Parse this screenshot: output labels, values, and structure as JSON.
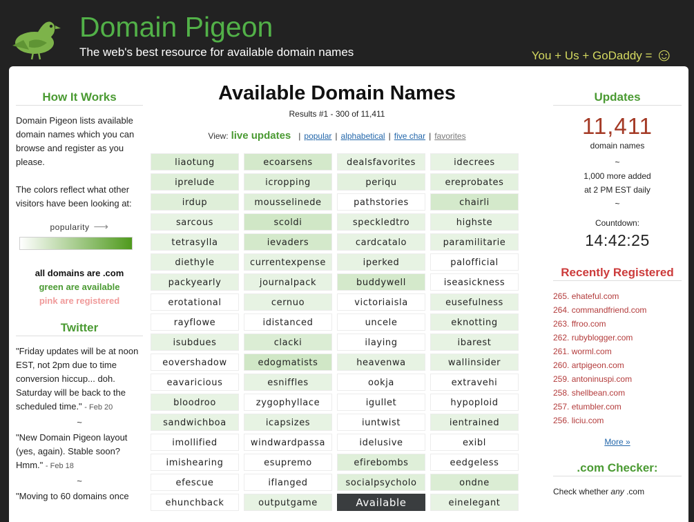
{
  "header": {
    "site_title": "Domain Pigeon",
    "tagline": "The web's best resource for available domain names",
    "partner_text": "You + Us + GoDaddy =",
    "partner_glyph": "☺",
    "logo_icon": "pigeon-icon"
  },
  "left": {
    "how_title": "How It Works",
    "how_text": "Domain Pigeon lists available domain names which you can browse and register as you please.",
    "colors_text": "The colors reflect what other visitors have been looking at:",
    "popularity_label": "popularity",
    "popularity_arrow": "⟶",
    "key_all": "all domains are .com",
    "key_green": "green are available",
    "key_pink": "pink are registered",
    "twitter_title": "Twitter",
    "tweets": [
      {
        "text": "\"Friday updates will be at noon EST, not 2pm due to time conversion hiccup... doh. Saturday will be back to the scheduled time.\"",
        "date": "- Feb 20"
      },
      {
        "text": "\"New Domain Pigeon layout (yes, again). Stable soon? Hmm.\"",
        "date": "- Feb 18"
      },
      {
        "text": "\"Moving to 60 domains once",
        "date": ""
      }
    ],
    "tilde": "~"
  },
  "center": {
    "title": "Available Domain Names",
    "results": "Results #1 - 300 of 11,411",
    "view_label": "View:",
    "views": {
      "live": "live updates",
      "popular": "popular",
      "alphabetical": "alphabetical",
      "five_char": "five char",
      "favorites": "favorites"
    },
    "domains": [
      [
        "liaotung",
        0.45
      ],
      [
        "ecoarsens",
        0.55
      ],
      [
        "dealsfavorites",
        0.3
      ],
      [
        "idecrees",
        0.3
      ],
      [
        "iprelude",
        0.4
      ],
      [
        "icropping",
        0.4
      ],
      [
        "periqu",
        0.35
      ],
      [
        "ereprobates",
        0.35
      ],
      [
        "irdup",
        0.4
      ],
      [
        "mousselinede",
        0.4
      ],
      [
        "pathstories",
        0.0
      ],
      [
        "chairli",
        0.55
      ],
      [
        "sarcous",
        0.3
      ],
      [
        "scoldi",
        0.6
      ],
      [
        "speckledtro",
        0.3
      ],
      [
        "highste",
        0.3
      ],
      [
        "tetrasylla",
        0.3
      ],
      [
        "ievaders",
        0.55
      ],
      [
        "cardcatalo",
        0.3
      ],
      [
        "paramilitarie",
        0.3
      ],
      [
        "diethyle",
        0.3
      ],
      [
        "currentexpense",
        0.3
      ],
      [
        "iperked",
        0.3
      ],
      [
        "palofficial",
        0.0
      ],
      [
        "packyearly",
        0.3
      ],
      [
        "journalpack",
        0.3
      ],
      [
        "buddywell",
        0.55
      ],
      [
        "iseasickness",
        0.0
      ],
      [
        "erotational",
        0.0
      ],
      [
        "cernuo",
        0.3
      ],
      [
        "victoriaisla",
        0.0
      ],
      [
        "eusefulness",
        0.3
      ],
      [
        "rayflowe",
        0.0
      ],
      [
        "idistanced",
        0.0
      ],
      [
        "uncele",
        0.0
      ],
      [
        "eknotting",
        0.3
      ],
      [
        "isubdues",
        0.3
      ],
      [
        "clacki",
        0.45
      ],
      [
        "ilaying",
        0.0
      ],
      [
        "ibarest",
        0.3
      ],
      [
        "eovershadow",
        0.0
      ],
      [
        "edogmatists",
        0.6
      ],
      [
        "heavenwa",
        0.3
      ],
      [
        "wallinsider",
        0.3
      ],
      [
        "eavaricious",
        0.0
      ],
      [
        "esniffles",
        0.3
      ],
      [
        "ookja",
        0.0
      ],
      [
        "extravehi",
        0.0
      ],
      [
        "bloodroo",
        0.3
      ],
      [
        "zygophyllace",
        0.0
      ],
      [
        "igullet",
        0.0
      ],
      [
        "hypoploid",
        0.0
      ],
      [
        "sandwichboa",
        0.3
      ],
      [
        "icapsizes",
        0.3
      ],
      [
        "iuntwist",
        0.0
      ],
      [
        "ientrained",
        0.3
      ],
      [
        "imollified",
        0.0
      ],
      [
        "windwardpassa",
        0.0
      ],
      [
        "idelusive",
        0.0
      ],
      [
        "exibl",
        0.0
      ],
      [
        "imishearing",
        0.0
      ],
      [
        "esupremo",
        0.0
      ],
      [
        "efirebombs",
        0.4
      ],
      [
        "eedgeless",
        0.0
      ],
      [
        "efescue",
        0.0
      ],
      [
        "iflanged",
        0.0
      ],
      [
        "socialpsycholo",
        0.4
      ],
      [
        "ondne",
        0.45
      ],
      [
        "ehunchback",
        0.0
      ],
      [
        "outputgame",
        0.3
      ],
      [
        "Available",
        -1
      ],
      [
        "einelegant",
        0.3
      ]
    ]
  },
  "right": {
    "updates_title": "Updates",
    "count": "11,411",
    "count_label": "domain names",
    "tilde": "~",
    "added_line1": "1,000 more added",
    "added_line2": "at 2 PM EST daily",
    "countdown_label": "Countdown:",
    "countdown_value": "14:42:25",
    "recent_title": "Recently Registered",
    "recent": [
      [
        "265.",
        "ehateful.com"
      ],
      [
        "264.",
        "commandfriend.com"
      ],
      [
        "263.",
        "ffroo.com"
      ],
      [
        "262.",
        "rubyblogger.com"
      ],
      [
        "261.",
        "worml.com"
      ],
      [
        "260.",
        "artpigeon.com"
      ],
      [
        "259.",
        "antoninuspi.com"
      ],
      [
        "258.",
        "shellbean.com"
      ],
      [
        "257.",
        "etumbler.com"
      ],
      [
        "256.",
        "liciu.com"
      ]
    ],
    "more": "More »",
    "checker_title": ".com Checker:",
    "checker_text_1": "Check whether",
    "checker_text_em": "any",
    "checker_text_2": ".com"
  },
  "colors": {
    "green": "#4a9a32",
    "red": "#cc3b3b",
    "count": "#a43a26",
    "header_bg": "#222222",
    "title_green": "#52b148"
  }
}
